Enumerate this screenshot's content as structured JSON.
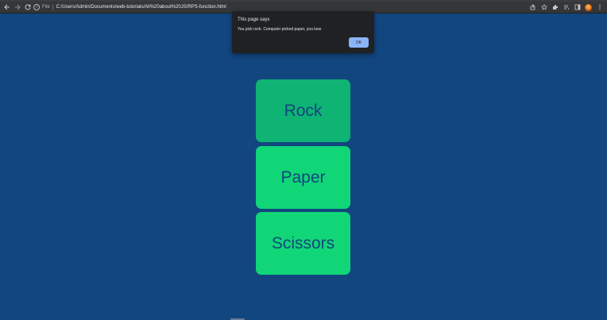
{
  "browser": {
    "info_label": "File",
    "url": "C:/Users/Admin/Documents/web-tutorials/All%20about%20JS/RPS-function.html",
    "icons": {
      "back": "arrow-left-icon",
      "forward": "arrow-right-icon",
      "reload": "reload-icon",
      "info": "info-icon",
      "share": "share-icon",
      "bookmark": "star-icon",
      "extensions": "puzzle-icon",
      "media": "media-control-icon",
      "side_panel": "side-panel-icon",
      "profile": "avatar",
      "menu": "kebab-menu-icon"
    }
  },
  "dialog": {
    "title": "This page says",
    "message": "You pick rock. Computer picked paper, you lose",
    "ok_label": "OK"
  },
  "game": {
    "buttons": [
      {
        "label": "Rock",
        "color": "#0fb373"
      },
      {
        "label": "Paper",
        "color": "#10d678"
      },
      {
        "label": "Scissors",
        "color": "#10d678"
      }
    ],
    "text_color": "#12467f"
  },
  "theme": {
    "page_background": "#12467f",
    "dialog_background": "#202124",
    "ok_button_color": "#8ab4f8"
  }
}
